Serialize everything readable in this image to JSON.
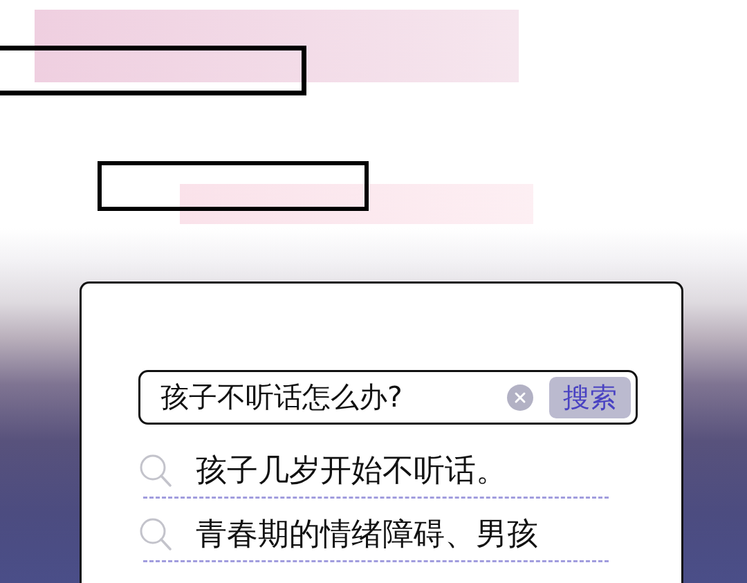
{
  "search": {
    "value": "孩子不听话怎么办?",
    "button": "搜索"
  },
  "suggestions": [
    {
      "text": "孩子几岁开始不听话。"
    },
    {
      "text": "青春期的情绪障碍、男孩"
    }
  ]
}
